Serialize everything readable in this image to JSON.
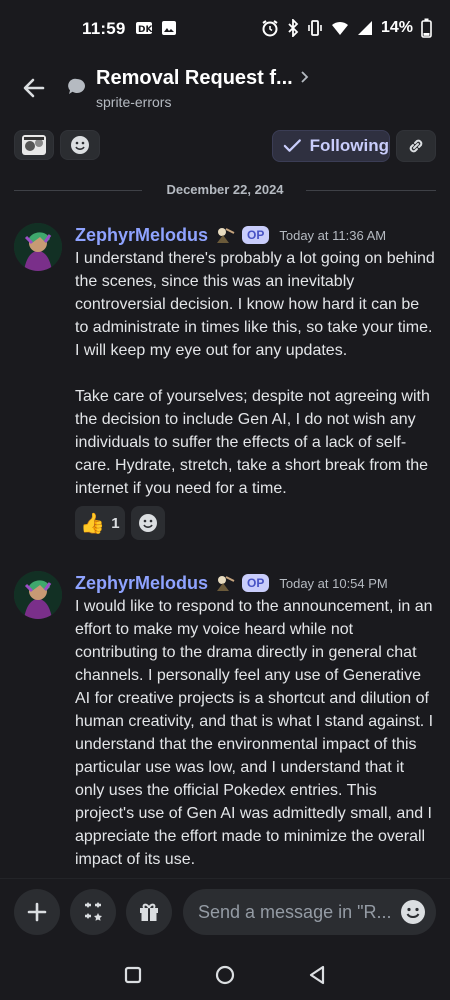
{
  "status": {
    "time": "11:59",
    "battery": "14%"
  },
  "header": {
    "title": "Removal Request f...",
    "subtitle": "sprite-errors"
  },
  "toolbar": {
    "following_label": "Following"
  },
  "divider": {
    "date": "December 22, 2024"
  },
  "messages": [
    {
      "author": "ZephyrMelodus",
      "badge": "OP",
      "timestamp": "Today at 11:36 AM",
      "paragraphs": [
        "I understand there's probably a lot going on behind the scenes, since this was an inevitably controversial decision. I know how hard it can be to administrate in times like this, so take your time. I will keep my eye out for any updates.",
        "Take care of yourselves; despite not agreeing with the decision to include Gen AI, I do not wish any individuals to suffer the effects of a lack of self-care. Hydrate, stretch, take a short break from the internet if you need for a time."
      ],
      "reactions": [
        {
          "emoji": "👍",
          "count": "1"
        }
      ]
    },
    {
      "author": "ZephyrMelodus",
      "badge": "OP",
      "timestamp": "Today at 10:54 PM",
      "paragraphs": [
        "I would like to respond to the announcement, in an effort to make my voice heard while not contributing to the drama directly in general chat channels. I personally feel any use of Generative AI for creative projects is a shortcut and dilution of human creativity, and that is what I stand against. I understand that the environmental impact of this particular use was low, and I understand that it only uses the official Pokedex entries. This project's use of Gen AI was admittedly small, and I appreciate the effort made to minimize the overall impact of its use."
      ]
    }
  ],
  "composer": {
    "placeholder": "Send a message in \"R..."
  },
  "colors": {
    "background": "#1a1a1e",
    "accent": "#8fa3ff",
    "following_text": "#c9cdfb"
  }
}
